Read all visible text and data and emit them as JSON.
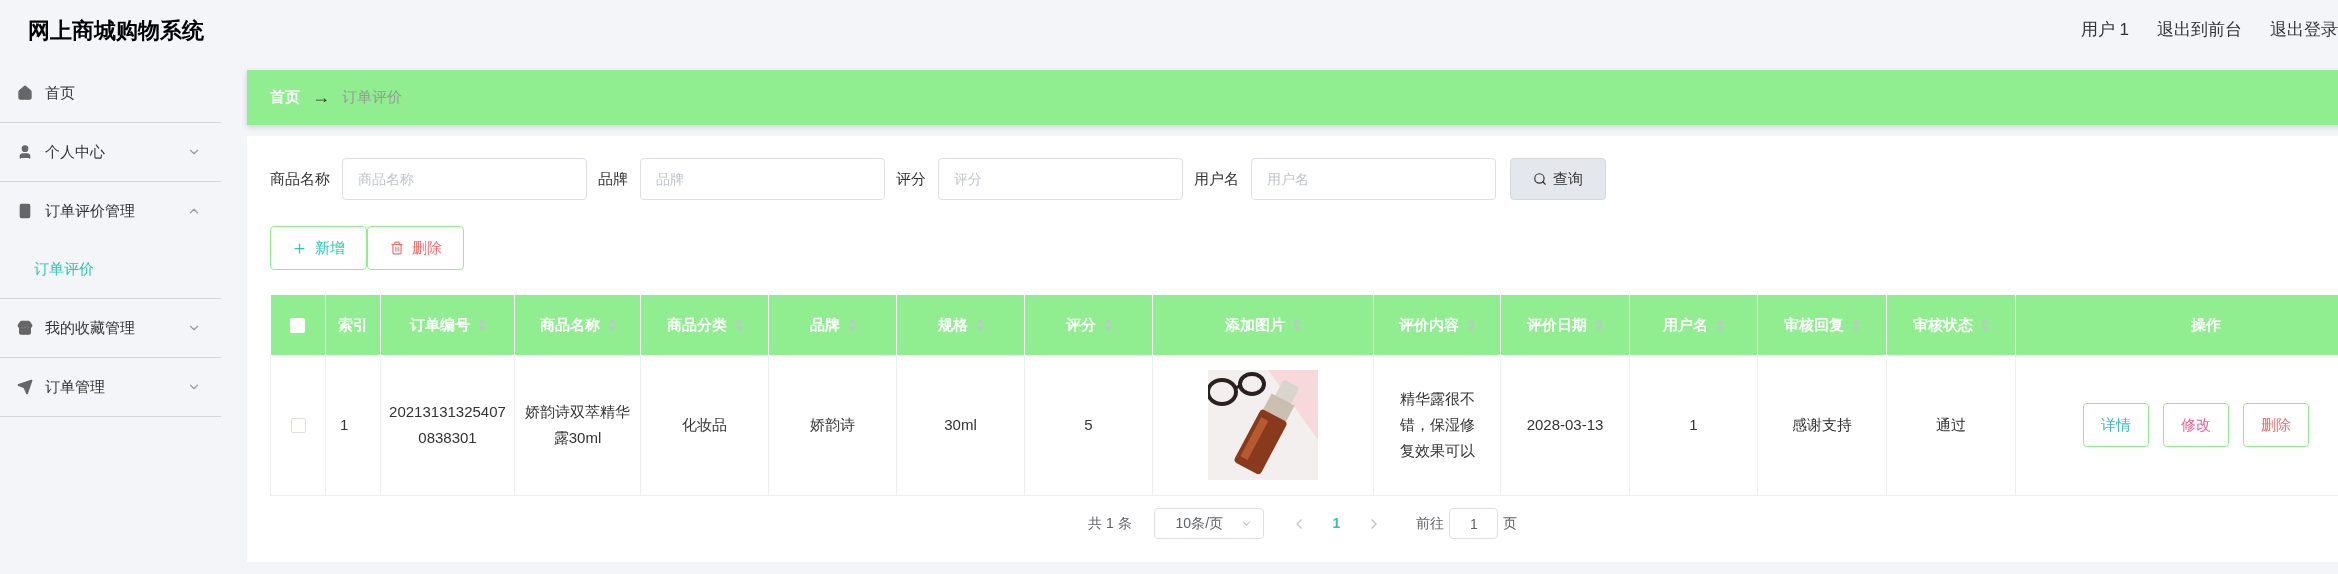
{
  "header": {
    "title": "网上商城购物系统",
    "links": [
      "用户 1",
      "退出到前台",
      "退出登录"
    ]
  },
  "sidebar": {
    "items": [
      {
        "label": "首页"
      },
      {
        "label": "个人中心",
        "expanded": false
      },
      {
        "label": "订单评价管理",
        "expanded": true,
        "children": [
          {
            "label": "订单评价",
            "selected": true
          }
        ]
      },
      {
        "label": "我的收藏管理",
        "expanded": false
      },
      {
        "label": "订单管理",
        "expanded": false
      }
    ]
  },
  "breadcrumb": {
    "items": [
      "首页",
      "订单评价"
    ],
    "separator": "→"
  },
  "search": {
    "fields": [
      {
        "label": "商品名称",
        "placeholder": "商品名称"
      },
      {
        "label": "品牌",
        "placeholder": "品牌"
      },
      {
        "label": "评分",
        "placeholder": "评分"
      },
      {
        "label": "用户名",
        "placeholder": "用户名"
      }
    ],
    "button": "查询"
  },
  "actions": [
    "新增",
    "删除"
  ],
  "table": {
    "select_all": {
      "checked": false
    },
    "columns": [
      {
        "label": "索引",
        "sortable": false
      },
      {
        "label": "订单编号",
        "sortable": true
      },
      {
        "label": "商品名称",
        "sortable": true
      },
      {
        "label": "商品分类",
        "sortable": true
      },
      {
        "label": "品牌",
        "sortable": true
      },
      {
        "label": "规格",
        "sortable": true
      },
      {
        "label": "评分",
        "sortable": true
      },
      {
        "label": "添加图片",
        "sortable": true
      },
      {
        "label": "评价内容",
        "sortable": true
      },
      {
        "label": "评价日期",
        "sortable": true
      },
      {
        "label": "用户名",
        "sortable": true
      },
      {
        "label": "审核回复",
        "sortable": true
      },
      {
        "label": "审核状态",
        "sortable": true
      },
      {
        "label": "操作",
        "sortable": false
      }
    ],
    "rows": [
      {
        "checked": false,
        "cells": [
          "1",
          "202131313254070838301",
          "娇韵诗双萃精华露30ml",
          "化妆品",
          "娇韵诗",
          "30ml",
          "5",
          {
            "kind": "picture"
          },
          "精华露很不错，保湿修复效果可以",
          "2028-03-13",
          "1",
          "感谢支持",
          "通过"
        ],
        "buttons": [
          "详情",
          "修改",
          "删除"
        ]
      }
    ]
  },
  "pagination": {
    "total": "共 1 条",
    "page_size": "10条/页",
    "pages": [
      {
        "label": "1",
        "selected": true
      }
    ],
    "goto_label": "前往",
    "goto_value": "1",
    "goto_suffix": "页"
  }
}
